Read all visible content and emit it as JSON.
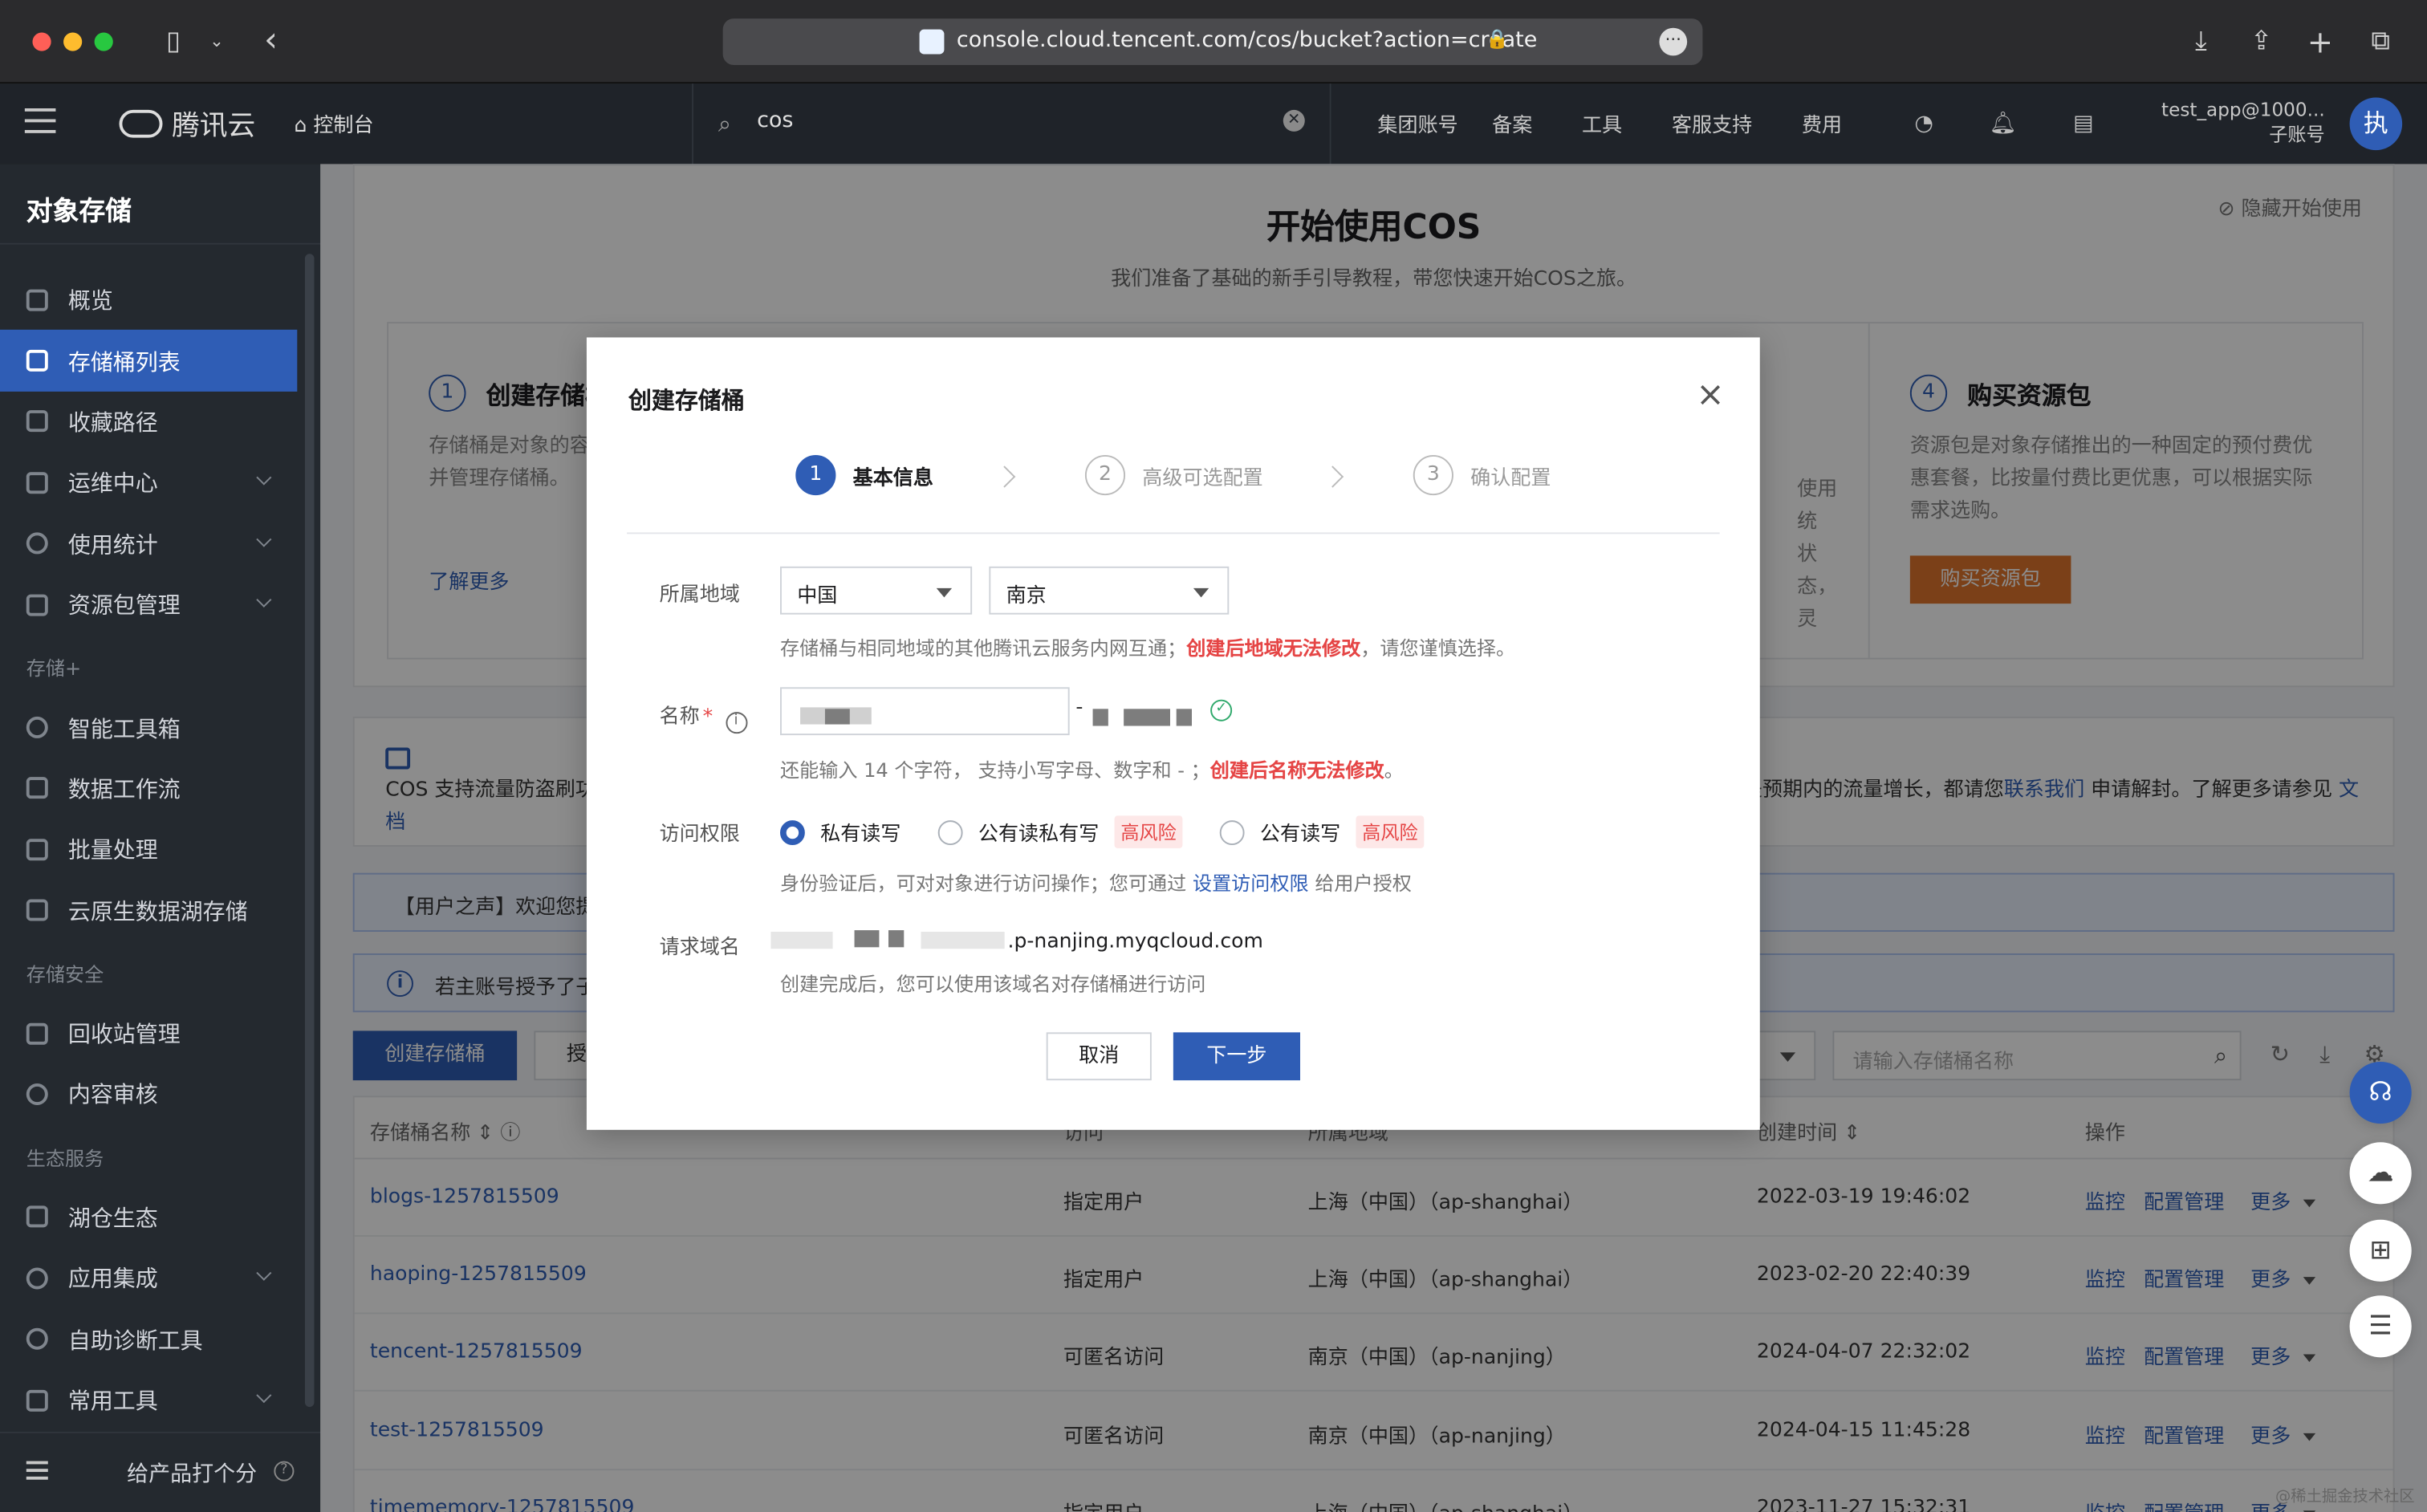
{
  "browser": {
    "url": "console.cloud.tencent.com/cos/bucket?action=create"
  },
  "topnav": {
    "brand": "腾讯云",
    "console": "控制台",
    "search_value": "cos",
    "links": [
      "集团账号",
      "备案",
      "工具",
      "客服支持",
      "费用"
    ],
    "account_name": "test_app@1000...",
    "account_type": "子账号",
    "avatar_letter": "执"
  },
  "sidebar": {
    "title": "对象存储",
    "items": [
      {
        "label": "概览"
      },
      {
        "label": "存储桶列表"
      },
      {
        "label": "收藏路径"
      },
      {
        "label": "运维中心"
      },
      {
        "label": "使用统计"
      },
      {
        "label": "资源包管理"
      }
    ],
    "group1": "存储+",
    "items2": [
      {
        "label": "智能工具箱"
      },
      {
        "label": "数据工作流"
      },
      {
        "label": "批量处理"
      },
      {
        "label": "云原生数据湖存储"
      }
    ],
    "group2": "存储安全",
    "items3": [
      {
        "label": "回收站管理"
      },
      {
        "label": "内容审核"
      }
    ],
    "group3": "生态服务",
    "items4": [
      {
        "label": "湖仓生态"
      },
      {
        "label": "应用集成"
      },
      {
        "label": "自助诊断工具"
      },
      {
        "label": "常用工具"
      }
    ],
    "footer": "给产品打个分"
  },
  "intro": {
    "title": "开始使用COS",
    "subtitle": "我们准备了基础的新手引导教程，带您快速开始COS之旅。",
    "hide": "隐藏开始使用",
    "step1_title": "创建存储桶",
    "step1_desc": "存储桶是对象的容器，您可通过控制台创建并管理存储桶。",
    "step1_link": "了解更多",
    "step4_title": "购买资源包",
    "step4_desc": "资源包是对象存储推出的一种固定的预付费优惠套餐，比按量付费比更优惠，可以根据实际需求选购。",
    "step4_button": "购买资源包",
    "mid_fragment": "使用统\n状态，灵"
  },
  "notice": {
    "lead": "COS",
    "text": "支持流量防盗刷功",
    "right_text": "是预期内的流量增长，都请您",
    "right_link": "联系我们",
    "right_tail": "申请解封。了解更多请参见",
    "doc_link": "文",
    "doc_link2": "档"
  },
  "voice": "【用户之声】欢迎您提交",
  "notice2": "若主账号授予了子",
  "toolbar": {
    "create": "创建存储桶",
    "second": "授",
    "search_placeholder": "请输入存储桶名称"
  },
  "table": {
    "headers": [
      "存储桶名称",
      "访问",
      "所属地域",
      "创建时间",
      "操作"
    ],
    "rows": [
      {
        "name": "blogs-1257815509",
        "access": "指定用户",
        "region": "上海（中国）（ap-shanghai）",
        "created": "2022-03-19 19:46:02"
      },
      {
        "name": "haoping-1257815509",
        "access": "指定用户",
        "region": "上海（中国）（ap-shanghai）",
        "created": "2023-02-20 22:40:39"
      },
      {
        "name": "tencent-1257815509",
        "access": "可匿名访问",
        "region": "南京（中国）（ap-nanjing）",
        "created": "2024-04-07 22:32:02"
      },
      {
        "name": "test-1257815509",
        "access": "可匿名访问",
        "region": "南京（中国）（ap-nanjing）",
        "created": "2024-04-15 11:45:28"
      },
      {
        "name": "timememory-1257815509",
        "access": "指定用户",
        "region": "上海（中国）（ap-shanghai）",
        "created": "2023-11-27 15:32:31"
      }
    ],
    "ops": [
      "监控",
      "配置管理",
      "更多"
    ]
  },
  "modal": {
    "title": "创建存储桶",
    "steps": [
      {
        "num": "1",
        "label": "基本信息"
      },
      {
        "num": "2",
        "label": "高级可选配置"
      },
      {
        "num": "3",
        "label": "确认配置"
      }
    ],
    "region_label": "所属地域",
    "region_country": "中国",
    "region_city": "南京",
    "region_hint": "存储桶与相同地域的其他腾讯云服务内网互通；",
    "region_warn": "创建后地域无法修改",
    "region_hint_tail": "，请您谨慎选择。",
    "name_label": "名称",
    "name_required": "*",
    "name_hint": "还能输入 14 个字符， 支持小写字母、数字和 - ；",
    "name_warn": "创建后名称无法修改",
    "name_hint_tail": "。",
    "access_label": "访问权限",
    "access_options": [
      {
        "label": "私有读写",
        "risk": ""
      },
      {
        "label": "公有读私有写",
        "risk": "高风险"
      },
      {
        "label": "公有读写",
        "risk": "高风险"
      }
    ],
    "access_hint": "身份验证后，可对对象进行访问操作；您可通过",
    "access_link": "设置访问权限",
    "access_hint_tail": "给用户授权",
    "domain_label": "请求域名",
    "domain_value": ".p-nanjing.myqcloud.com",
    "domain_hint": "创建完成后，您可以使用该域名对存储桶进行访问",
    "cancel": "取消",
    "next": "下一步"
  },
  "watermark": "@稀土掘金技术社区"
}
